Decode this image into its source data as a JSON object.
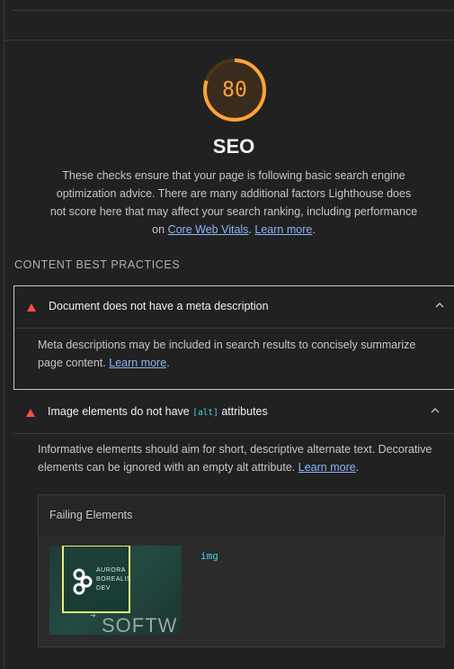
{
  "score": {
    "value": "80",
    "fraction": 0.8,
    "color": "#ffa33a"
  },
  "category": {
    "title": "SEO",
    "description": "These checks ensure that your page is following basic search engine optimization advice. There are many additional factors Lighthouse does not score here that may affect your search ranking, including performance on",
    "link1": "Core Web Vitals",
    "separator": ".",
    "link2": "Learn more",
    "end": "."
  },
  "group": {
    "title": "Content Best Practices"
  },
  "audits": [
    {
      "title": "Document does not have a meta description",
      "description": "Meta descriptions may be included in search results to concisely summarize page content.",
      "learn_more": "Learn more",
      "end": "."
    },
    {
      "title_before": "Image elements do not have",
      "title_code": "[alt]",
      "title_after": "attributes",
      "description": "Informative elements should aim for short, descriptive alternate text. Decorative elements can be ignored with an empty alt attribute.",
      "learn_more": "Learn more",
      "end": ".",
      "table_header": "Failing Elements",
      "node": "img",
      "thumbnail": {
        "line1": "AURORA",
        "line2": "BOREALIS",
        "line3": "DEV",
        "big_text": "SOFTW"
      }
    }
  ],
  "colors": {
    "fail": "#ff4e42",
    "link": "#8ab4f8",
    "code": "#4dd0e1",
    "background": "#212121"
  }
}
